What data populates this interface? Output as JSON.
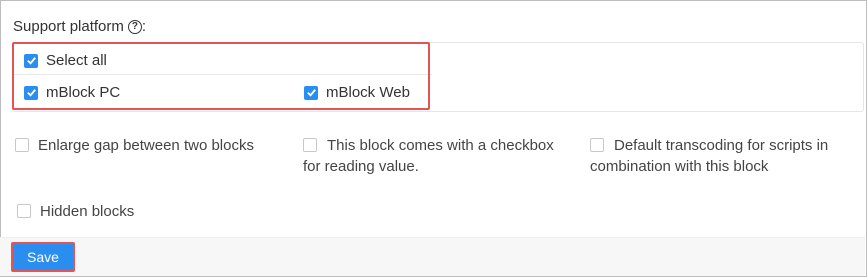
{
  "support_platform": {
    "label": "Support platform",
    "help_glyph": "?",
    "suffix": ":",
    "select_all": {
      "label": "Select all",
      "checked": true
    },
    "platforms": [
      {
        "label": "mBlock PC",
        "checked": true
      },
      {
        "label": "mBlock Web",
        "checked": true
      }
    ]
  },
  "options": [
    {
      "line1": "Enlarge gap between two blocks",
      "line2": "",
      "checked": false
    },
    {
      "line1": "This block comes with a checkbox",
      "line2": "for reading value.",
      "checked": false
    },
    {
      "line1": "Default transcoding for scripts in",
      "line2": "combination with this block",
      "checked": false
    },
    {
      "line1": "Hidden blocks",
      "line2": "",
      "checked": false
    }
  ],
  "footer": {
    "save_label": "Save"
  },
  "colors": {
    "accent": "#2a8ef0",
    "highlight": "#e45454"
  }
}
